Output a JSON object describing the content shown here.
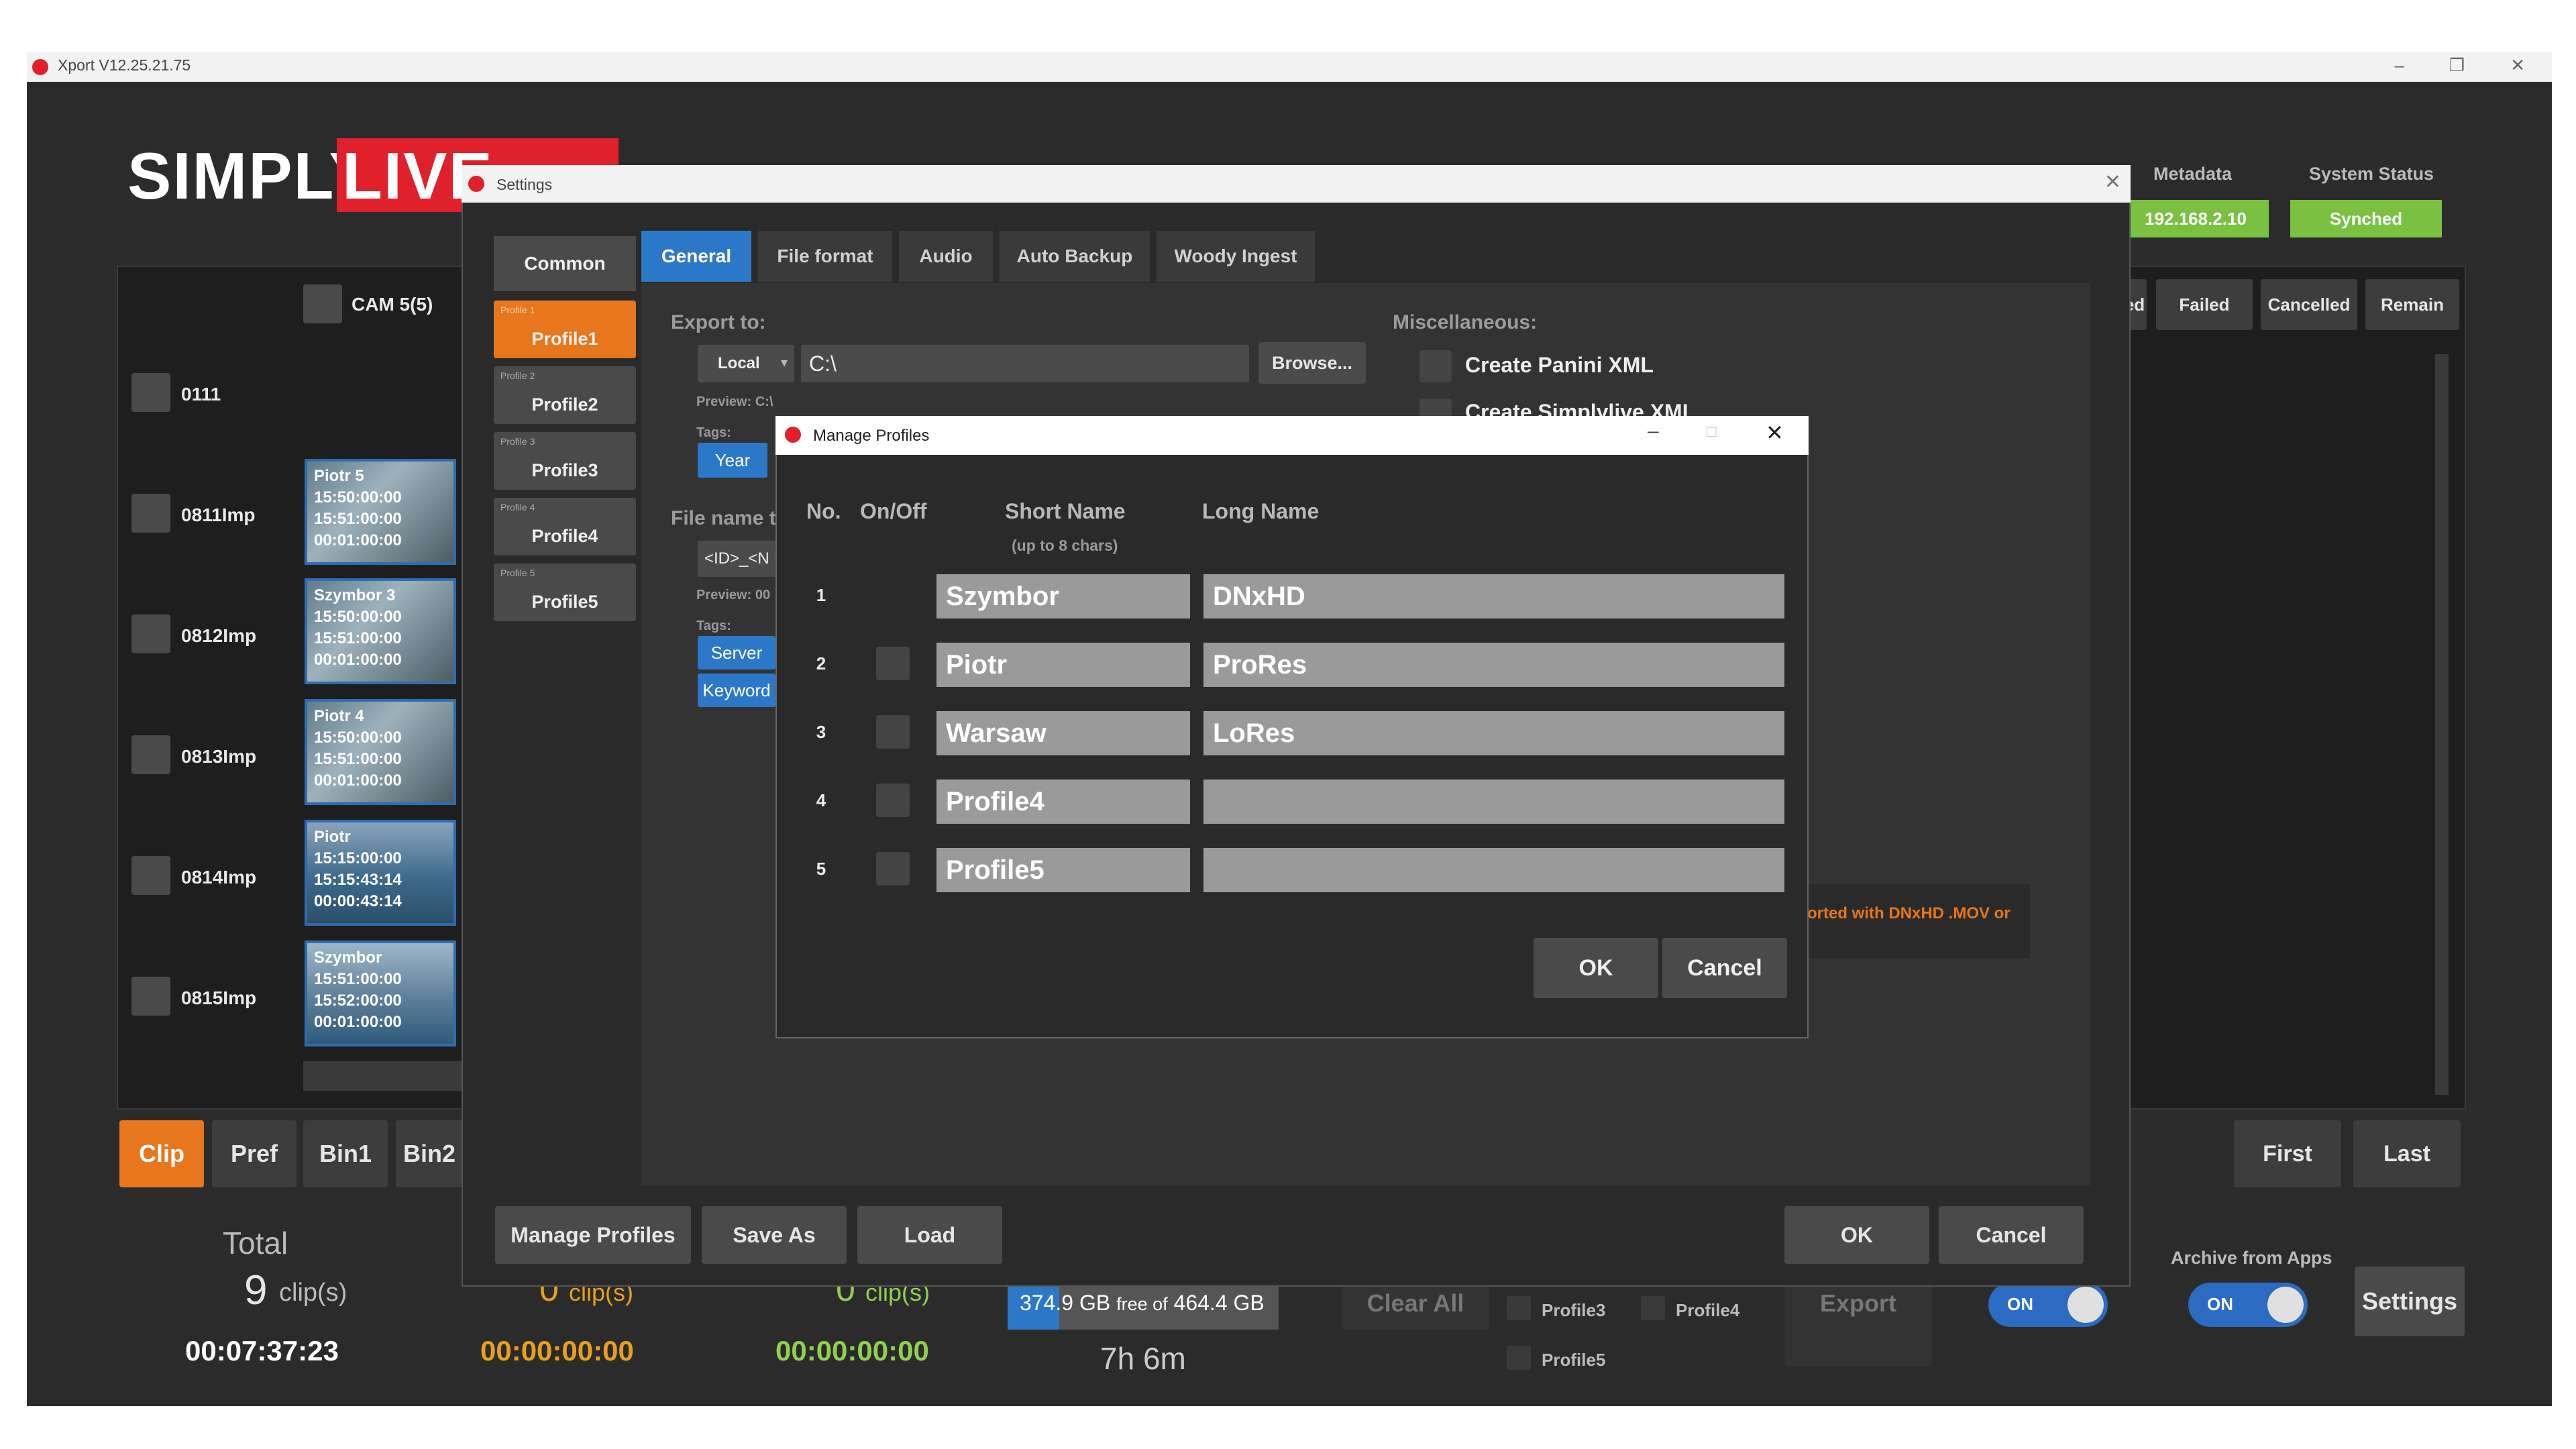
{
  "app": {
    "title": "Xport V12.25.21.75",
    "logo_text": "SIMPLYLIVE",
    "header": {
      "metadata_label": "Metadata",
      "metadata_value": "192.168.2.10",
      "system_status_label": "System Status",
      "system_status_value": "Synched"
    },
    "camera_label": "CAM 5(5)",
    "clips": [
      {
        "label": "0111"
      },
      {
        "label": "0811Imp",
        "thumb": {
          "name": "Piotr 5",
          "in": "15:50:00:00",
          "out": "15:51:00:00",
          "dur": "00:01:00:00"
        }
      },
      {
        "label": "0812Imp",
        "thumb": {
          "name": "Szymbor 3",
          "in": "15:50:00:00",
          "out": "15:51:00:00",
          "dur": "00:01:00:00"
        }
      },
      {
        "label": "0813Imp",
        "thumb": {
          "name": "Piotr 4",
          "in": "15:50:00:00",
          "out": "15:51:00:00",
          "dur": "00:01:00:00"
        }
      },
      {
        "label": "0814Imp",
        "thumb": {
          "name": "Piotr",
          "in": "15:15:00:00",
          "out": "15:15:43:14",
          "dur": "00:00:43:14"
        }
      },
      {
        "label": "0815Imp",
        "thumb": {
          "name": "Szymbor",
          "in": "15:51:00:00",
          "out": "15:52:00:00",
          "dur": "00:01:00:00"
        }
      }
    ],
    "status_tabs": [
      "ed",
      "Failed",
      "Cancelled",
      "Remain"
    ],
    "bottom_tabs": [
      "Clip",
      "Pref",
      "Bin1",
      "Bin2"
    ],
    "nav": {
      "first": "First",
      "last": "Last"
    },
    "totals": {
      "total_label": "Total",
      "total_count": "9",
      "clips_unit": "clip(s)",
      "total_duration": "00:07:37:23",
      "col2_count": "0",
      "col2_duration": "00:00:00:00",
      "col3_count": "0",
      "col3_duration": "00:00:00:00"
    },
    "storage": {
      "free": "374.9 GB",
      "free_of": "free of",
      "total": "464.4 GB",
      "time_left": "7h 6m",
      "used_fraction": 0.19
    },
    "clear_all": "Clear All",
    "export_label": "Export",
    "profile_checks": [
      "Profile3",
      "Profile4",
      "Profile5"
    ],
    "toggle_label": "ON",
    "archive_label": "Archive from Apps",
    "archive_toggle": "ON",
    "settings_button": "Settings"
  },
  "settings": {
    "title": "Settings",
    "common_tab": "Common",
    "tabs": [
      "General",
      "File format",
      "Audio",
      "Auto Backup",
      "Woody Ingest"
    ],
    "profiles": [
      {
        "small": "Profile 1",
        "name": "Profile1"
      },
      {
        "small": "Profile 2",
        "name": "Profile2"
      },
      {
        "small": "Profile 3",
        "name": "Profile3"
      },
      {
        "small": "Profile 4",
        "name": "Profile4"
      },
      {
        "small": "Profile 5",
        "name": "Profile5"
      }
    ],
    "export_to_label": "Export to:",
    "export_mode": "Local",
    "export_path": "C:\\",
    "browse": "Browse...",
    "preview_label": "Preview: C:\\",
    "tags_label": "Tags:",
    "tag_year": "Year",
    "file_name_label": "File name t",
    "file_name_value": "<ID>_<N",
    "preview2_label": "Preview: 00",
    "tags2_label": "Tags:",
    "tag_server": "Server",
    "tag_keyword": "Keyword",
    "misc_label": "Miscellaneous:",
    "misc_panini": "Create Panini XML",
    "misc_simplylive": "Create Simplylive XML",
    "info_text": "orted with DNxHD .MOV or",
    "footer": {
      "manage": "Manage Profiles",
      "save_as": "Save As",
      "load": "Load",
      "ok": "OK",
      "cancel": "Cancel"
    }
  },
  "manage_profiles": {
    "title": "Manage Profiles",
    "headers": {
      "no": "No.",
      "onoff": "On/Off",
      "short": "Short Name",
      "short_hint": "(up to 8 chars)",
      "long": "Long Name"
    },
    "rows": [
      {
        "no": "1",
        "short": "Szymbor",
        "long": "DNxHD",
        "has_toggle": false
      },
      {
        "no": "2",
        "short": "Piotr",
        "long": "ProRes",
        "has_toggle": true
      },
      {
        "no": "3",
        "short": "Warsaw",
        "long": "LoRes",
        "has_toggle": true
      },
      {
        "no": "4",
        "short": "Profile4",
        "long": "",
        "has_toggle": true
      },
      {
        "no": "5",
        "short": "Profile5",
        "long": "",
        "has_toggle": true
      }
    ],
    "ok": "OK",
    "cancel": "Cancel"
  }
}
